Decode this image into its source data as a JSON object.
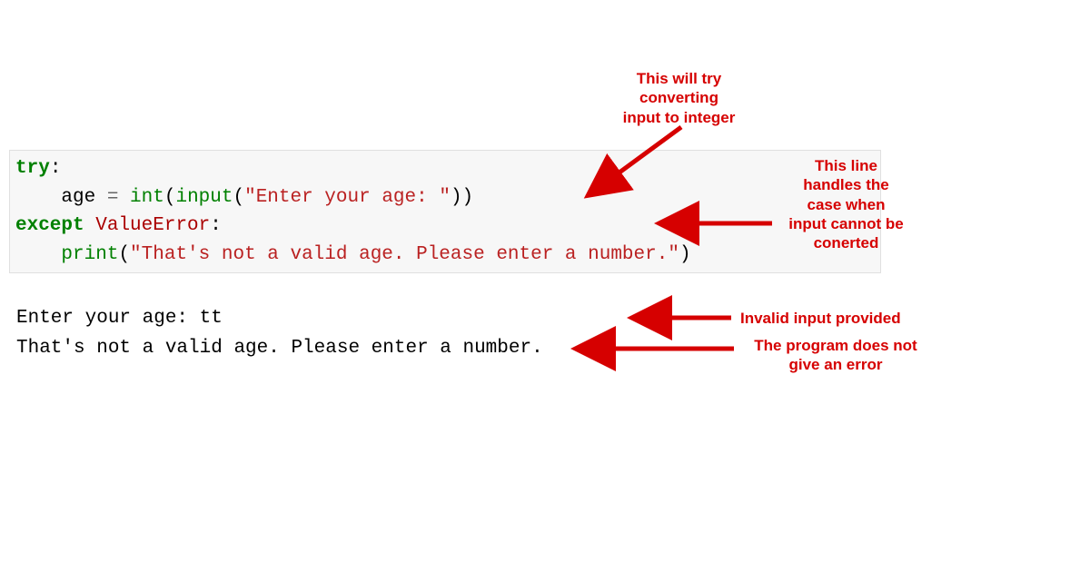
{
  "code": {
    "try_kw": "try",
    "colon1": ":",
    "indent": "    ",
    "var_age": "age",
    "equals": " = ",
    "int_fn": "int",
    "open_paren1": "(",
    "input_fn": "input",
    "open_paren2": "(",
    "input_str": "\"Enter your age: \"",
    "close_parens": "))",
    "except_kw": "except",
    "space": " ",
    "exc_name": "ValueError",
    "colon2": ":",
    "print_fn": "print",
    "open_paren3": "(",
    "print_str": "\"That's not a valid age. Please enter a number.\"",
    "close_paren3": ")"
  },
  "output": {
    "line1": "Enter your age: tt",
    "line2": "That's not a valid age. Please enter a number."
  },
  "annotations": {
    "a1_1": "This will try",
    "a1_2": "converting",
    "a1_3": "input to integer",
    "a2_1": "This line",
    "a2_2": "handles the",
    "a2_3": "case when",
    "a2_4": "input cannot be",
    "a2_5": "conerted",
    "a3": "Invalid input provided",
    "a4_1": "The program does not",
    "a4_2": "give an error"
  },
  "colors": {
    "annotation": "#d60000",
    "keyword": "#008000",
    "string": "#ba2121"
  }
}
